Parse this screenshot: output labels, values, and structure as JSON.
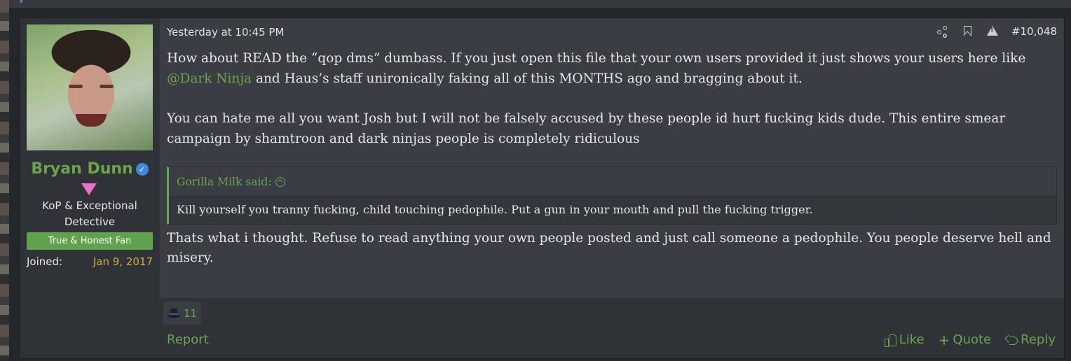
{
  "post": {
    "timestamp": "Yesterday at 10:45 PM",
    "post_number": "#10,048",
    "author": {
      "name": "Bryan Dunn",
      "title_line1": "KoP & Exceptional",
      "title_line2": "Detective",
      "banner": "True & Honest Fan",
      "joined_label": "Joined:",
      "joined_value": "Jan 9, 2017",
      "verified_icon": "verified-check-icon",
      "rank_icon": "pink-triangle-icon"
    },
    "body": {
      "p1_a": "How about READ the “qop dms” dumbass. If you just open this file that your own users provided it just shows your users here like ",
      "p1_mention": "@Dark Ninja",
      "p1_b": " and Haus’s staff unironically faking all of this MONTHS ago and bragging about it.",
      "p2": "You can hate me all you want Josh but I will not be falsely accused by these people id hurt fucking kids dude. This entire smear campaign by shamtroon and dark ninjas people is completely ridiculous",
      "quote_author": "Gorilla Milk said:",
      "quote_text": "Kill yourself you tranny fucking, child touching pedophile. Put a gun in your mouth and pull the fucking trigger.",
      "p3": "Thats what i thought. Refuse to read anything your own people posted and just call someone a pedophile. You people deserve hell and misery."
    },
    "reactions": {
      "icon": "top-hat-icon",
      "count": "11"
    },
    "footer": {
      "report": "Report",
      "like": "Like",
      "quote": "Quote",
      "reply": "Reply"
    }
  },
  "colors": {
    "accent_green": "#6ba44b",
    "joined_gold": "#cfae3e",
    "post_bg": "#3a3e44",
    "page_bg": "#24282d"
  }
}
